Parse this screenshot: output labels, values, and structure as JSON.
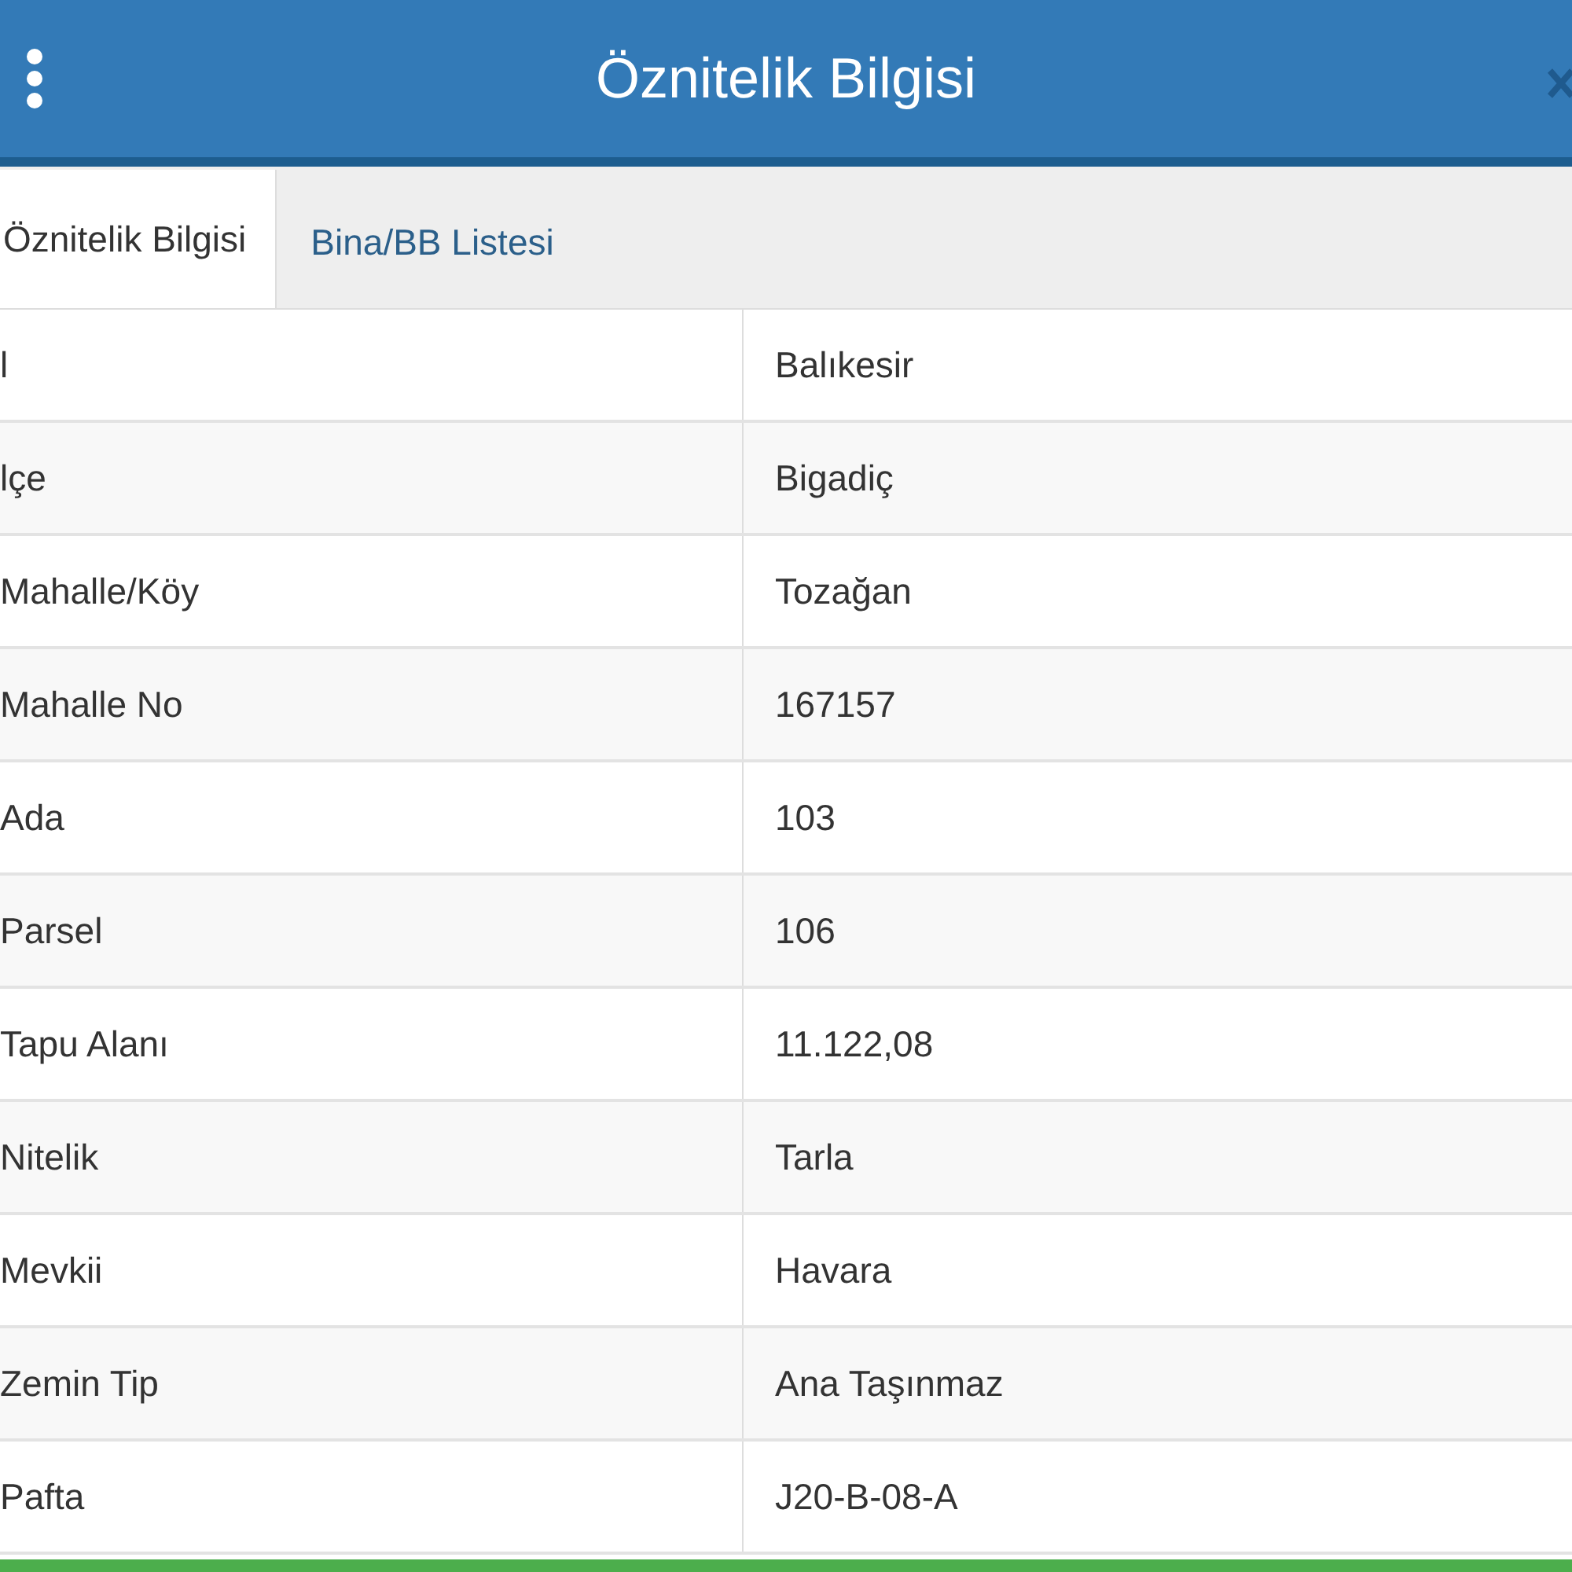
{
  "window": {
    "title": "Öznitelik Bilgisi"
  },
  "tabs": [
    {
      "label": "Öznitelik Bilgisi",
      "selected": true
    },
    {
      "label": "Bina/BB Listesi",
      "selected": false
    }
  ],
  "table": {
    "rows": [
      {
        "label": "l",
        "value": "Balıkesir"
      },
      {
        "label": "lçe",
        "value": "Bigadiç"
      },
      {
        "label": "Mahalle/Köy",
        "value": "Tozağan"
      },
      {
        "label": "Mahalle No",
        "value": "167157"
      },
      {
        "label": "Ada",
        "value": "103"
      },
      {
        "label": "Parsel",
        "value": "106"
      },
      {
        "label": "Tapu Alanı",
        "value": "11.122,08"
      },
      {
        "label": "Nitelik",
        "value": "Tarla"
      },
      {
        "label": "Mevkii",
        "value": "Havara"
      },
      {
        "label": "Zemin Tip",
        "value": "Ana Taşınmaz"
      },
      {
        "label": "Pafta",
        "value": "J20-B-08-A"
      }
    ]
  }
}
